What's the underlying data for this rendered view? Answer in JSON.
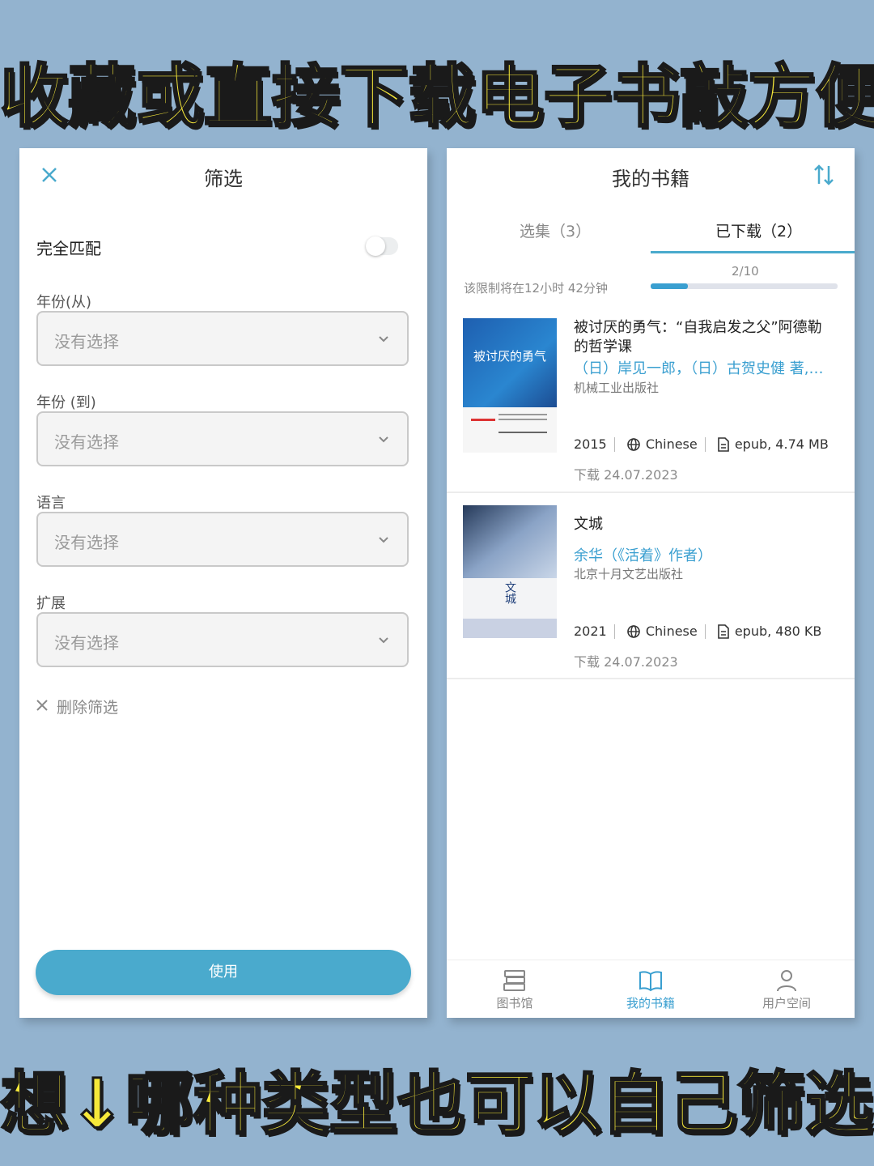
{
  "headline_top": "收藏或直接下载电子书敲方便",
  "headline_bottom": "想↓哪种类型也可以自己筛选",
  "filter_panel": {
    "title": "筛选",
    "exact_match_label": "完全匹配",
    "exact_match_on": false,
    "fields": [
      {
        "label": "年份(从)",
        "value": "没有选择"
      },
      {
        "label": "年份 (到)",
        "value": "没有选择"
      },
      {
        "label": "语言",
        "value": "没有选择"
      },
      {
        "label": "扩展",
        "value": "没有选择"
      }
    ],
    "clear_label": "删除筛选",
    "apply_label": "使用"
  },
  "books_panel": {
    "title": "我的书籍",
    "tabs": {
      "collections": "选集（3）",
      "downloaded": "已下载（2）"
    },
    "limit_text": "该限制将在12小时 42分钟",
    "progress_label": "2/10",
    "progress_fraction": 0.2,
    "books": [
      {
        "title": "被讨厌的勇气：“自我启发之父”阿德勒的哲学课",
        "author": "（日）岸见一郎，（日）古贺史健 著,…",
        "publisher": "机械工业出版社",
        "year": "2015",
        "language": "Chinese",
        "format": "epub, 4.74 MB",
        "downloaded": "下载 24.07.2023",
        "cover_text": "被讨厌的勇气"
      },
      {
        "title": "文城",
        "author": "余华（《活着》作者）",
        "publisher": "北京十月文艺出版社",
        "year": "2021",
        "language": "Chinese",
        "format": "epub, 480 KB",
        "downloaded": "下载 24.07.2023",
        "cover_text": "文城"
      }
    ],
    "nav": [
      {
        "label": "图书馆",
        "icon": "library-icon"
      },
      {
        "label": "我的书籍",
        "icon": "book-open-icon"
      },
      {
        "label": "用户空间",
        "icon": "user-icon"
      }
    ]
  },
  "colors": {
    "accent": "#4aaacd",
    "headline": "#f7e93a",
    "background": "#93b3cf"
  }
}
